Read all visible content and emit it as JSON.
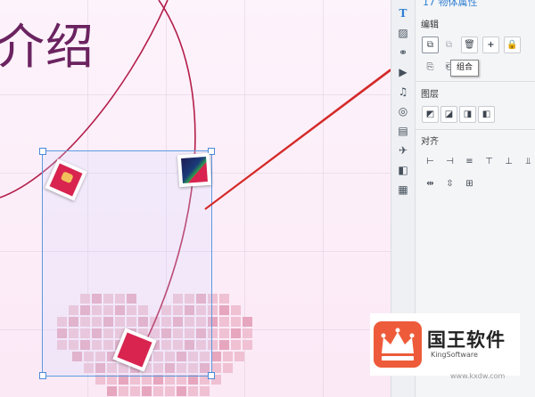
{
  "canvas": {
    "title_text": "介绍"
  },
  "panel": {
    "header": "17 物体属性",
    "sections": {
      "edit_label": "编辑",
      "layer_label": "图层",
      "align_label": "对齐"
    },
    "tooltip": "组合",
    "side_icons": [
      "text-icon",
      "image-icon",
      "link-icon",
      "video-icon",
      "music-icon",
      "shape-icon",
      "page-icon",
      "plane-icon",
      "layers-icon",
      "layout-icon"
    ]
  },
  "watermark": {
    "brand_cn": "国王软件",
    "brand_en": "KingSoftware",
    "site": "www.kxdw.com"
  },
  "colors": {
    "accent_blue": "#2f7fd1",
    "title_purple": "#6b2360",
    "photo_red": "#d8244f",
    "arrow_red": "#d42a2a"
  }
}
